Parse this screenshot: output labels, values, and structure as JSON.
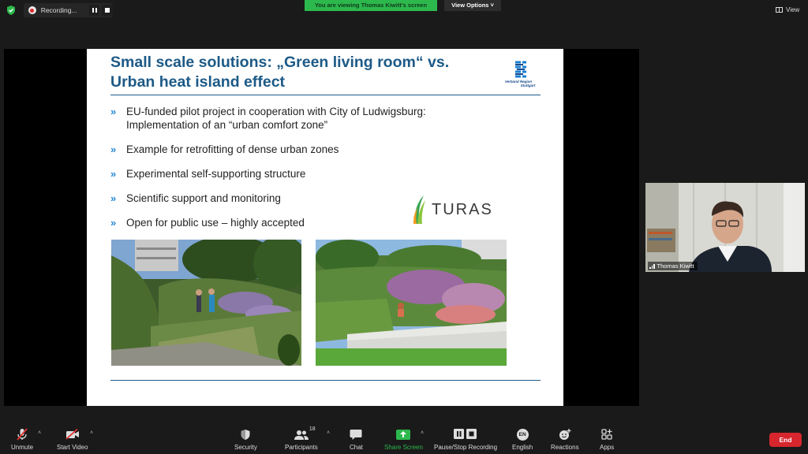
{
  "top_bar": {
    "recording_text": "Recording...",
    "viewing_banner": "You are viewing Thomas Kiwitt's screen",
    "view_options": "View Options ˅",
    "view_label": "View"
  },
  "slide": {
    "title": "Small scale solutions: „Green living room“ vs. Urban heat island effect",
    "logo_text_line1": "Verband Region",
    "logo_text_line2": "Stuttgart",
    "bullet_mark": "»",
    "bullets": [
      {
        "text": "EU-funded pilot project in cooperation with City of Ludwigsburg: Implementation  of an “urban comfort zone”"
      },
      {
        "text": "Example for retrofitting of dense urban zones"
      },
      {
        "text": "Experimental self-supporting structure"
      },
      {
        "text": "Scientific support and monitoring"
      },
      {
        "text": "Open for public use – highly accepted"
      }
    ],
    "turas_logo_text": "TURAS"
  },
  "participant": {
    "name": "Thomas Kiwitt"
  },
  "toolbar": {
    "unmute": "Unmute",
    "start_video": "Start Video",
    "security": "Security",
    "participants": "Participants",
    "participants_count": "18",
    "chat": "Chat",
    "share_screen": "Share Screen",
    "recording": "Pause/Stop Recording",
    "english": "English",
    "english_icon": "EN",
    "reactions": "Reactions",
    "apps": "Apps",
    "end": "End",
    "caret": "˄"
  },
  "colors": {
    "background": "#1a1a1a",
    "banner_green": "#2db84d",
    "end_red": "#d7262d",
    "slide_title_blue": "#1d5a87",
    "bullet_blue": "#2a8bd5"
  },
  "icons": [
    "shield-check-icon",
    "record-icon",
    "pause-icon",
    "stop-icon",
    "view-grid-icon",
    "mic-muted-icon",
    "video-off-icon",
    "security-shield-icon",
    "participants-icon",
    "chat-icon",
    "share-screen-icon",
    "recording-controls-icon",
    "language-icon",
    "reactions-icon",
    "apps-icon"
  ]
}
